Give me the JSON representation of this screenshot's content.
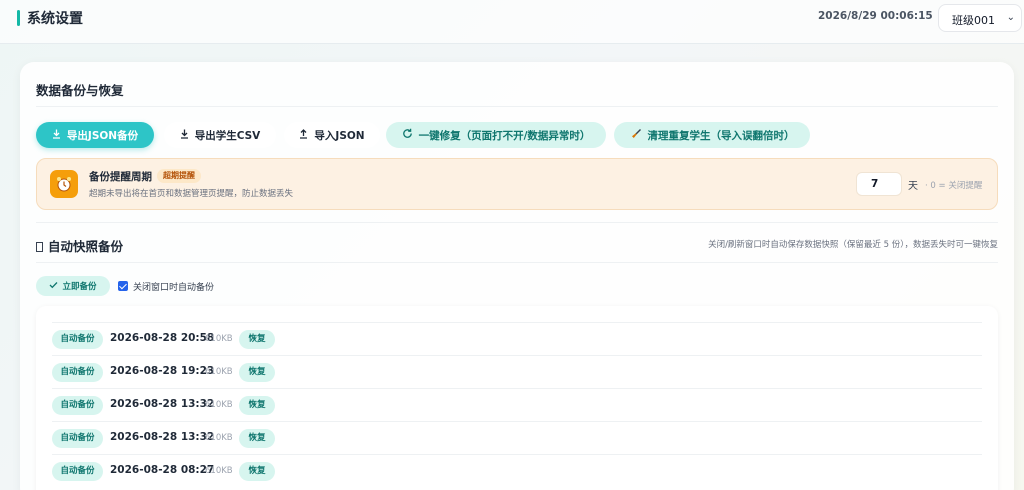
{
  "header": {
    "title": "系统设置",
    "datetime": "2026/8/29 00:06:15",
    "class_select": "班级001"
  },
  "backup": {
    "section_title": "数据备份与恢复",
    "buttons": {
      "export_json": "导出JSON备份",
      "export_csv": "导出学生CSV",
      "import_json": "导入JSON",
      "repair": "一键修复（页面打不开/数据异常时）",
      "clean": "清理重复学生（导入误翻倍时）"
    },
    "icons": {
      "export_json": "download-icon",
      "export_csv": "download-icon",
      "import_json": "upload-icon",
      "repair": "refresh-icon",
      "clean": "broom-icon",
      "reminder": "alarm-clock-icon"
    },
    "reminder": {
      "title": "备份提醒周期",
      "badge": "超期提醒",
      "desc": "超期未导出将在首页和数据管理页提醒，防止数据丢失",
      "days": "7",
      "unit": "天",
      "hint": "· 0 = 关闭提醒"
    }
  },
  "auto_backup": {
    "title": "自动快照备份",
    "hint": "关闭/刷新窗口时自动保存数据快照（保留最近 5 份），数据丢失时可一键恢复",
    "backup_now": "立即备份",
    "auto_on_close_label": "关闭窗口时自动备份",
    "auto_on_close_checked": true,
    "rows": [
      {
        "tag": "自动备份",
        "time": "2026-08-28 20:58",
        "size": "610KB",
        "restore": "恢复"
      },
      {
        "tag": "自动备份",
        "time": "2026-08-28 19:23",
        "size": "610KB",
        "restore": "恢复"
      },
      {
        "tag": "自动备份",
        "time": "2026-08-28 13:32",
        "size": "610KB",
        "restore": "恢复"
      },
      {
        "tag": "自动备份",
        "time": "2026-08-28 13:32",
        "size": "610KB",
        "restore": "恢复"
      },
      {
        "tag": "自动备份",
        "time": "2026-08-28 08:27",
        "size": "610KB",
        "restore": "恢复"
      }
    ]
  },
  "colors": {
    "accent": "#2dc5c7",
    "mint": "#d7f5ef",
    "mint_text": "#0f766e",
    "warning_bg": "#fdf1e3",
    "warning_icon": "#f59e0b"
  }
}
